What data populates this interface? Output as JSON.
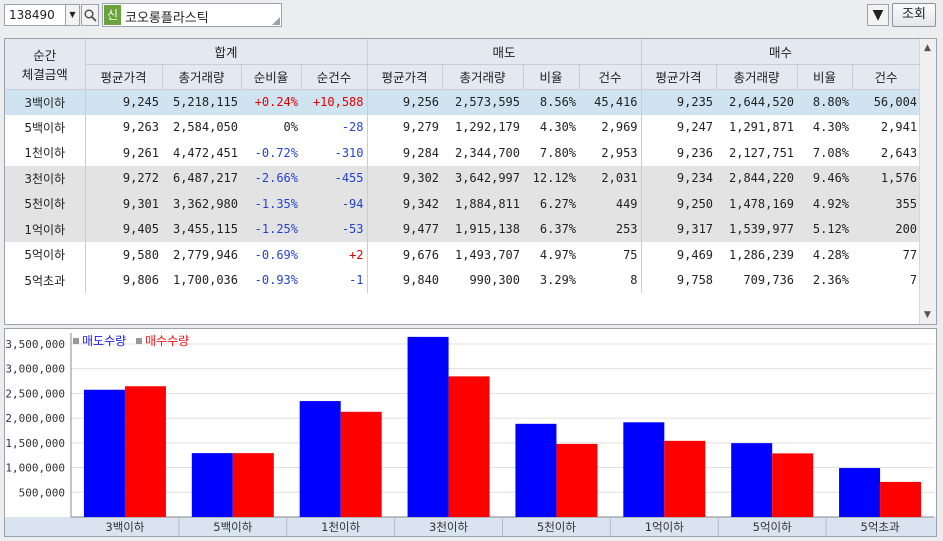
{
  "toolbar": {
    "code": "138490",
    "badge": "신",
    "name": "코오롱플라스틱",
    "query_label": "조회"
  },
  "table": {
    "header_first": [
      "순간",
      "체결금액"
    ],
    "groups": [
      "합계",
      "매도",
      "매수"
    ],
    "subheaders": [
      "평균가격",
      "총거래량",
      "순비율",
      "순건수",
      "평균가격",
      "총거래량",
      "비율",
      "건수",
      "평균가격",
      "총거래량",
      "비율",
      "건수"
    ],
    "rows": [
      {
        "label": "3백이하",
        "cells": [
          "9,245",
          "5,218,115",
          "+0.24%",
          "+10,588",
          "9,256",
          "2,573,595",
          "8.56%",
          "45,416",
          "9,235",
          "2,644,520",
          "8.80%",
          "56,004"
        ],
        "style": "hl"
      },
      {
        "label": "5백이하",
        "cells": [
          "9,263",
          "2,584,050",
          "0%",
          "-28",
          "9,279",
          "1,292,179",
          "4.30%",
          "2,969",
          "9,247",
          "1,291,871",
          "4.30%",
          "2,941"
        ],
        "style": ""
      },
      {
        "label": "1천이하",
        "cells": [
          "9,261",
          "4,472,451",
          "-0.72%",
          "-310",
          "9,284",
          "2,344,700",
          "7.80%",
          "2,953",
          "9,236",
          "2,127,751",
          "7.08%",
          "2,643"
        ],
        "style": ""
      },
      {
        "label": "3천이하",
        "cells": [
          "9,272",
          "6,487,217",
          "-2.66%",
          "-455",
          "9,302",
          "3,642,997",
          "12.12%",
          "2,031",
          "9,234",
          "2,844,220",
          "9.46%",
          "1,576"
        ],
        "style": "gr"
      },
      {
        "label": "5천이하",
        "cells": [
          "9,301",
          "3,362,980",
          "-1.35%",
          "-94",
          "9,342",
          "1,884,811",
          "6.27%",
          "449",
          "9,250",
          "1,478,169",
          "4.92%",
          "355"
        ],
        "style": "gr"
      },
      {
        "label": "1억이하",
        "cells": [
          "9,405",
          "3,455,115",
          "-1.25%",
          "-53",
          "9,477",
          "1,915,138",
          "6.37%",
          "253",
          "9,317",
          "1,539,977",
          "5.12%",
          "200"
        ],
        "style": "gr"
      },
      {
        "label": "5억이하",
        "cells": [
          "9,580",
          "2,779,946",
          "-0.69%",
          "+2",
          "9,676",
          "1,493,707",
          "4.97%",
          "75",
          "9,469",
          "1,286,239",
          "4.28%",
          "77"
        ],
        "style": ""
      },
      {
        "label": "5억초과",
        "cells": [
          "9,806",
          "1,700,036",
          "-0.93%",
          "-1",
          "9,840",
          "990,300",
          "3.29%",
          "8",
          "9,758",
          "709,736",
          "2.36%",
          "7"
        ],
        "style": ""
      }
    ]
  },
  "chart_data": {
    "type": "bar",
    "categories": [
      "3백이하",
      "5백이하",
      "1천이하",
      "3천이하",
      "5천이하",
      "1억이하",
      "5억이하",
      "5억초과"
    ],
    "series": [
      {
        "name": "매도수량",
        "color": "#0000ff",
        "values": [
          2573595,
          1292179,
          2344700,
          3642997,
          1884811,
          1915138,
          1493707,
          990300
        ]
      },
      {
        "name": "매수수량",
        "color": "#ff0000",
        "values": [
          2644520,
          1291871,
          2127751,
          2844220,
          1478169,
          1539977,
          1286239,
          709736
        ]
      }
    ],
    "yticks": [
      "500,000",
      "1,000,000",
      "1,500,000",
      "2,000,000",
      "2,500,000",
      "3,000,000",
      "3,500,000"
    ],
    "ylim": [
      0,
      3600000
    ],
    "grid": true,
    "legend": "top-left"
  }
}
